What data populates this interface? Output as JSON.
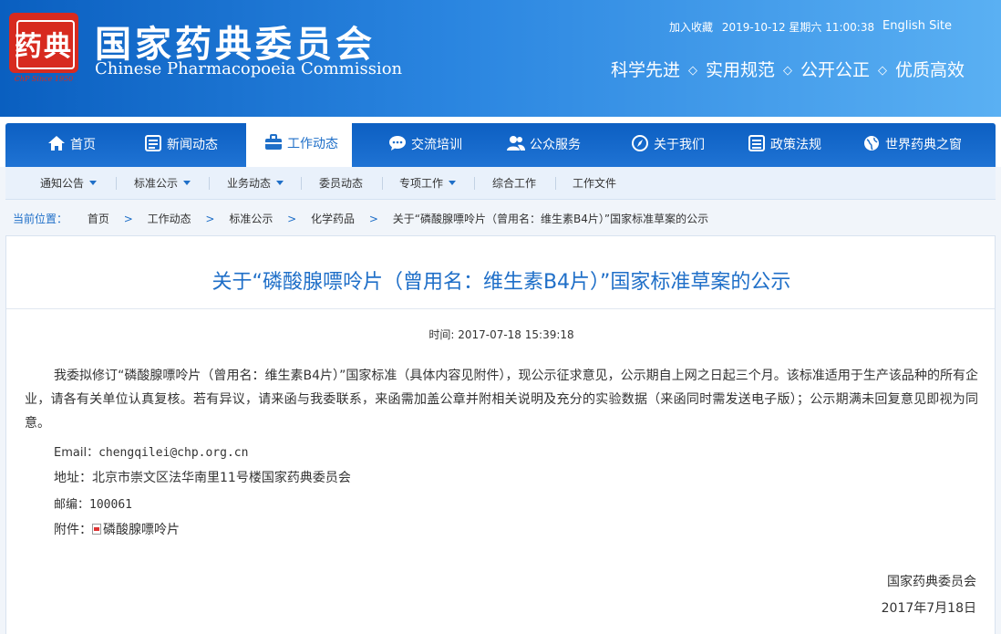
{
  "header": {
    "logo_chars": "药典",
    "logo_since": "ChP Since 1950",
    "title_cn": "国家药典委员会",
    "title_en": "Chinese Pharmacopoeia Commission",
    "favorite": "加入收藏",
    "datetime": "2019-10-12 星期六 11:00:38",
    "english_site": "English Site",
    "slogans": [
      "科学先进",
      "实用规范",
      "公开公正",
      "优质高效"
    ],
    "slogan_sep": "◇"
  },
  "main_nav": [
    {
      "label": "首页",
      "icon": "home-icon"
    },
    {
      "label": "新闻动态",
      "icon": "list-icon"
    },
    {
      "label": "工作动态",
      "icon": "briefcase-icon",
      "active": true
    },
    {
      "label": "交流培训",
      "icon": "chat-icon"
    },
    {
      "label": "公众服务",
      "icon": "users-icon"
    },
    {
      "label": "关于我们",
      "icon": "compass-icon"
    },
    {
      "label": "政策法规",
      "icon": "document-list-icon"
    },
    {
      "label": "世界药典之窗",
      "icon": "globe-icon"
    }
  ],
  "sub_nav": [
    {
      "label": "通知公告",
      "dropdown": true
    },
    {
      "label": "标准公示",
      "dropdown": true
    },
    {
      "label": "业务动态",
      "dropdown": true
    },
    {
      "label": "委员动态",
      "dropdown": false
    },
    {
      "label": "专项工作",
      "dropdown": true
    },
    {
      "label": "综合工作",
      "dropdown": false
    },
    {
      "label": "工作文件",
      "dropdown": false
    }
  ],
  "breadcrumb": {
    "lead": "当前位置：",
    "items": [
      "首页",
      "工作动态",
      "标准公示",
      "化学药品",
      "关于“磷酸腺嘌呤片（曾用名：维生素B4片）”国家标准草案的公示"
    ],
    "sep": ">"
  },
  "article": {
    "title": "关于“磷酸腺嘌呤片（曾用名：维生素B4片）”国家标准草案的公示",
    "time_label": "时间:",
    "time_value": "2017-07-18 15:39:18",
    "body": "我委拟修订“磷酸腺嘌呤片（曾用名：维生素B4片）”国家标准（具体内容见附件），现公示征求意见，公示期自上网之日起三个月。该标准适用于生产该品种的所有企业，请各有关单位认真复核。若有异议，请来函与我委联系，来函需加盖公章并附相关说明及充分的实验数据（来函同时需发送电子版）；公示期满未回复意见即视为同意。",
    "email_label": "Email：",
    "email": "chengqilei@chp.org.cn",
    "address_label": "地址：",
    "address": "北京市崇文区法华南里11号楼国家药典委员会",
    "postcode_label": "邮编：",
    "postcode": "100061",
    "attachment_label": "附件：",
    "attachment": "磷酸腺嘌呤片",
    "signature": "国家药典委员会",
    "date": "2017年7月18日"
  },
  "colors": {
    "brand_blue": "#1f6fc8",
    "header_gradient_start": "#0a5fc0",
    "header_gradient_end": "#5ab0f3",
    "seal_red": "#d72a1f"
  }
}
